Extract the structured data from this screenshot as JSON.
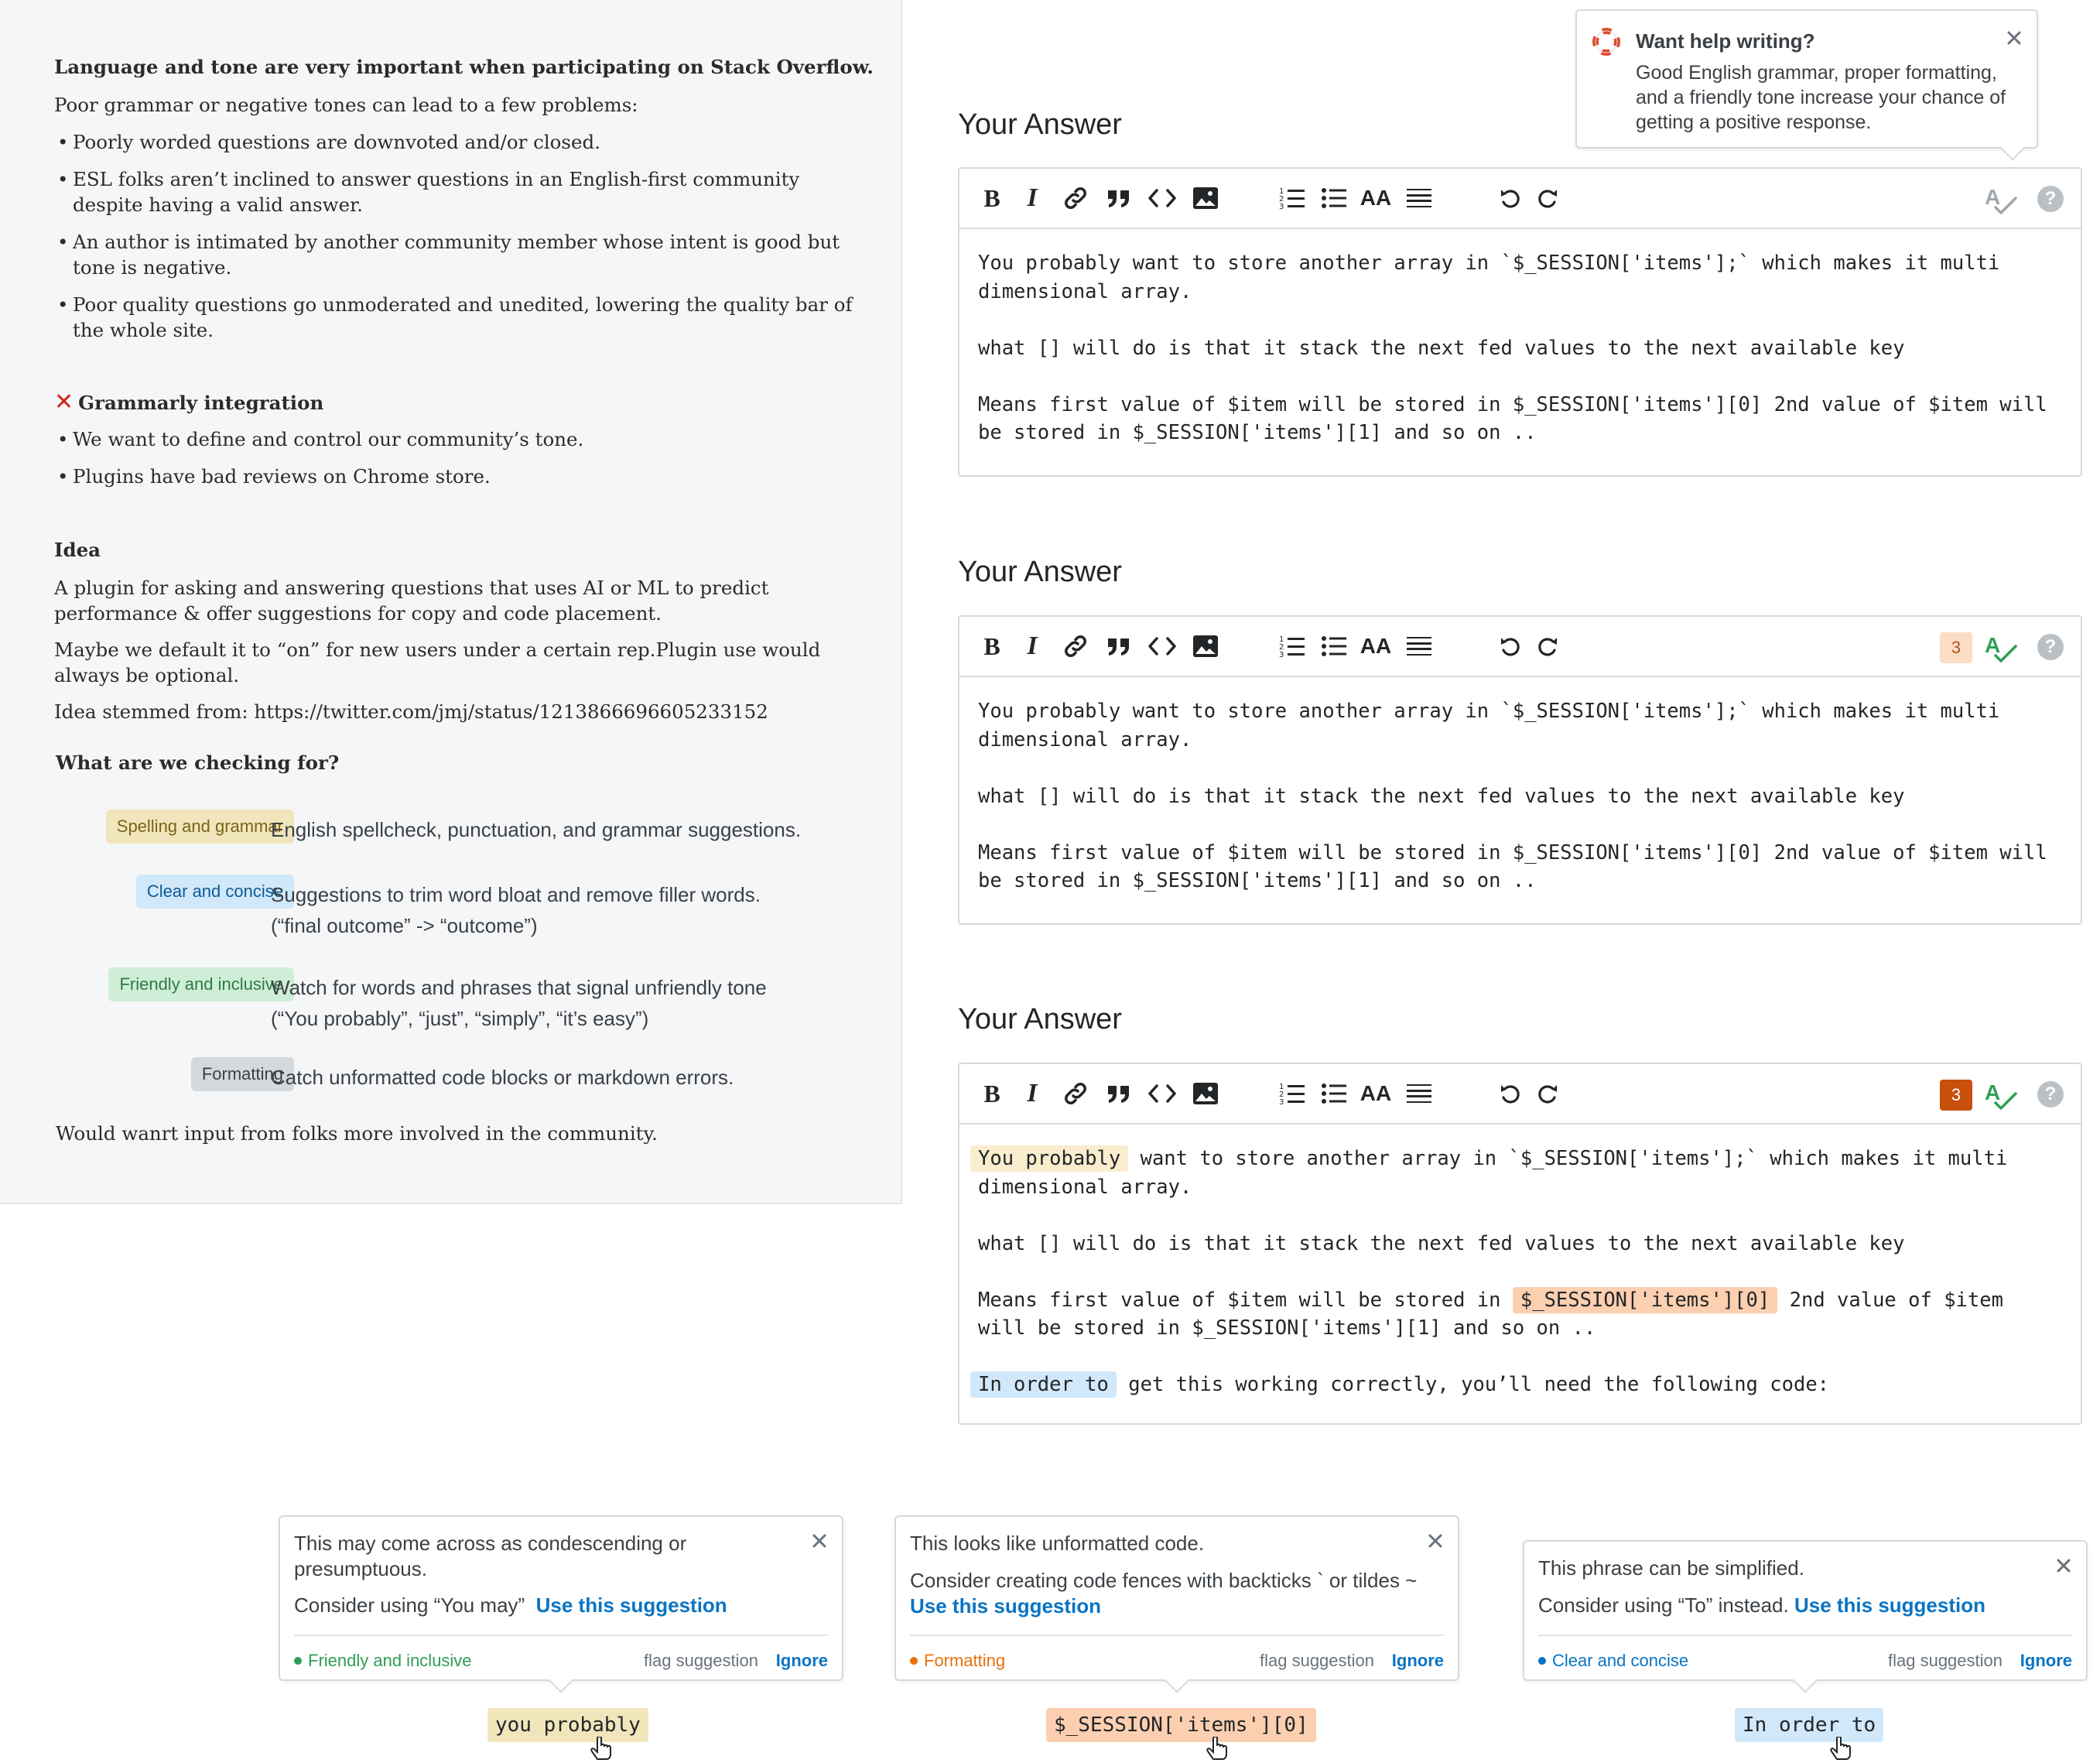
{
  "notes": {
    "heading": "Language and tone are very important when participating on Stack Overflow.",
    "intro": "Poor grammar or negative tones can lead to a few problems:",
    "problems": [
      "Poorly worded questions are downvoted and/or closed.",
      "ESL folks aren’t inclined to answer questions in an English-first community despite having a valid answer.",
      "An author is intimated by another community member whose intent is good but tone is negative.",
      "Poor quality questions go unmoderated and unedited, lowering the quality bar of the whole site."
    ],
    "grammarly_heading": "Grammarly integration",
    "grammarly_points": [
      "We want to define and control our community’s tone.",
      "Plugins have bad reviews on Chrome store."
    ],
    "idea_heading": "Idea",
    "idea_text_1": "A plugin for asking and answering questions that uses AI or ML to predict performance & offer suggestions for copy and code placement.",
    "idea_text_2": "Maybe we default it to “on” for new users under a certain rep.Plugin use would always be optional.",
    "idea_text_3": "Idea stemmed from: https://twitter.com/jmj/status/1213866696605233152",
    "checking_heading": "What are we checking for?",
    "checks": [
      {
        "badge": "Spelling and grammar",
        "desc": "English spellcheck, punctuation, and grammar suggestions.",
        "desc2": "",
        "bg": "#f1e5bc",
        "fg": "#7a6417"
      },
      {
        "badge": "Clear and concise",
        "desc": "Suggestions to trim word bloat and remove filler words.",
        "desc2": "(“final outcome” -> “outcome”)",
        "bg": "#d1e8fa",
        "fg": "#0d5a94"
      },
      {
        "badge": "Friendly and inclusive",
        "desc": "Watch for words and phrases that signal unfriendly tone",
        "desc2": "(“You probably”, “just”, “simply”, “it’s easy”)",
        "bg": "#cfeed7",
        "fg": "#2f7a43"
      },
      {
        "badge": "Formatting",
        "desc": "Catch unformatted code blocks or markdown errors.",
        "desc2": "",
        "bg": "#d6d9dc",
        "fg": "#3b4045"
      }
    ],
    "closing": "Would wanrt input from folks more involved in the community."
  },
  "help_popover": {
    "title": "Want help writing?",
    "body": "Good English grammar, proper formatting, and a friendly tone increase your chance of getting a positive response.",
    "icon": "lifebuoy-icon"
  },
  "editors": [
    {
      "title": "Your Answer",
      "badge_count": "",
      "badge_bg": "",
      "badge_fg": "",
      "check_color": "#9fa6ad",
      "lines": [
        "You probably want to store another array in `$_SESSION['items'];` which makes it multi dimensional array.",
        "what [] will do is that it stack the next fed values to the next available key",
        "Means first value of $item will be stored in $_SESSION['items'][0] 2nd value of $item will be stored in $_SESSION['items'][1] and so on .."
      ]
    },
    {
      "title": "Your Answer",
      "badge_count": "3",
      "badge_bg": "#fbdcc4",
      "badge_fg": "#b6541b",
      "check_color": "#2f9e55",
      "lines": [
        "You probably want to store another array in `$_SESSION['items'];` which makes it multi dimensional array.",
        "what [] will do is that it stack the next fed values to the next available key",
        "Means first value of $item will be stored in $_SESSION['items'][0] 2nd value of $item will be stored in $_SESSION['items'][1] and so on .."
      ]
    },
    {
      "title": "Your Answer",
      "badge_count": "3",
      "badge_bg": "#c84f0c",
      "badge_fg": "#ffffff",
      "check_color": "#2f9e55",
      "l1_hl": "You probably",
      "l1_rest": " want to store another array in `$_SESSION['items'];` which makes it multi dimensional array.",
      "l2": "what [] will do is that it stack the next fed values to the next available key",
      "l3_pre": "Means first value of $item will be stored in ",
      "l3_hl": "$_SESSION['items'][0]",
      "l3_post": " 2nd value of $item will be stored in $_SESSION['items'][1] and so on ..",
      "l4_hl": "In order to",
      "l4_rest": " get this working correctly, you’ll need the following code:"
    }
  ],
  "toolbar": {
    "icons": [
      "bold-icon",
      "italic-icon",
      "link-icon",
      "blockquote-icon",
      "code-icon",
      "image-icon",
      "ordered-list-icon",
      "unordered-list-icon",
      "heading-icon",
      "horizontal-rule-icon",
      "undo-icon",
      "redo-icon",
      "grammar-check-icon",
      "help-icon"
    ],
    "bold": "B",
    "italic": "I",
    "heading": "AA",
    "help": "?"
  },
  "cards": [
    {
      "line1": "This may come across as condescending or presumptuous.",
      "line2": "Consider using “You may”",
      "use": "Use this suggestion",
      "category": "Friendly and inclusive",
      "cat_color": "#2f9e55",
      "flag": "flag suggestion",
      "ignore": "Ignore",
      "chip": "you probably",
      "chip_bg": "#f1e5bc"
    },
    {
      "line1": "This looks like unformatted code.",
      "line2": "Consider creating code fences with backticks ` or tildes ~",
      "use": "Use this suggestion",
      "category": "Formatting",
      "cat_color": "#e8710a",
      "flag": "flag suggestion",
      "ignore": "Ignore",
      "chip": "$_SESSION['items'][0]",
      "chip_bg": "#fbcfb0"
    },
    {
      "line1": "This phrase can be simplified.",
      "line2": "Consider using “To” instead.",
      "use": "Use this suggestion",
      "category": "Clear and concise",
      "cat_color": "#0a74c4",
      "flag": "flag suggestion",
      "ignore": "Ignore",
      "chip": "In order to",
      "chip_bg": "#d1e8fa"
    }
  ]
}
